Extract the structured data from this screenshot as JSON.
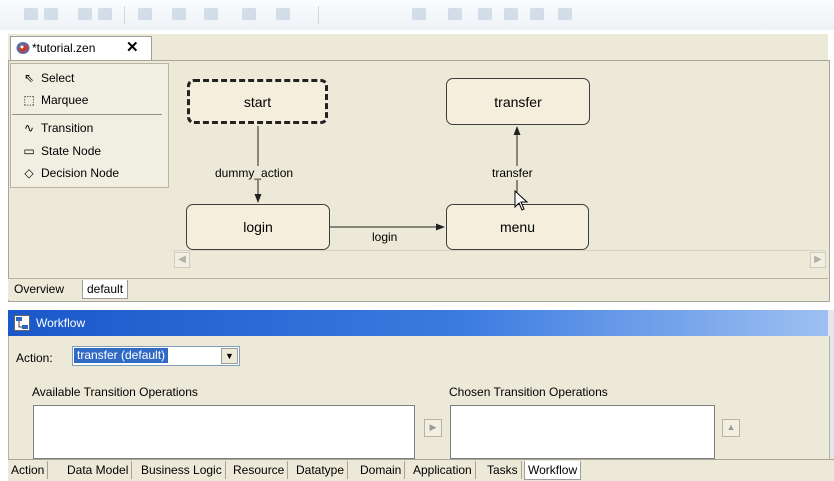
{
  "editor": {
    "tab_title": "*tutorial.zen",
    "close_symbol": "✕"
  },
  "palette": {
    "items": [
      {
        "label": "Select",
        "icon": "cursor-arrow-icon"
      },
      {
        "label": "Marquee",
        "icon": "marquee-icon"
      },
      {
        "label": "Transition",
        "icon": "transition-icon"
      },
      {
        "label": "State Node",
        "icon": "state-node-icon"
      },
      {
        "label": "Decision Node",
        "icon": "decision-node-icon"
      }
    ]
  },
  "diagram": {
    "nodes": {
      "start": "start",
      "transfer": "transfer",
      "login": "login",
      "menu": "menu"
    },
    "edges": {
      "dummy_action": "dummy_action",
      "login": "login",
      "transfer": "transfer"
    }
  },
  "editor_tabs": [
    "Overview",
    "default"
  ],
  "workflow": {
    "title": "Workflow",
    "action_label": "Action:",
    "action_value": "transfer (default)",
    "available_label": "Available Transition Operations",
    "chosen_label": "Chosen Transition Operations"
  },
  "page_tabs": [
    "Action",
    "Data Model",
    "Business Logic",
    "Resource",
    "Datatype",
    "Domain",
    "Application",
    "Tasks",
    "Workflow"
  ],
  "colors": {
    "title_bar": "#1a57c9",
    "selection": "#316ac5",
    "node_fill": "#f6eedd",
    "panel_bg": "#ece9d8"
  }
}
